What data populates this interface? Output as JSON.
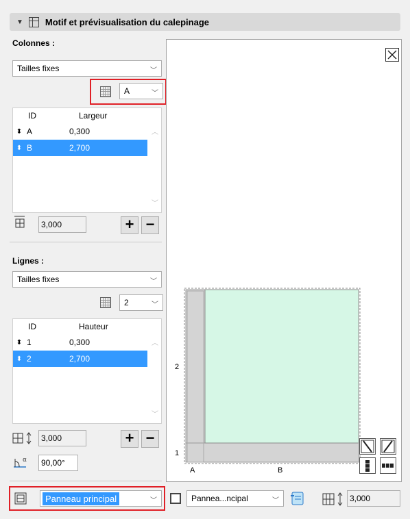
{
  "header": {
    "title": "Motif et prévisualisation du calepinage"
  },
  "columns": {
    "label": "Colonnes :",
    "mode": "Tailles fixes",
    "selector_value": "A",
    "table_headers": {
      "id": "ID",
      "value": "Largeur"
    },
    "rows": [
      {
        "id": "A",
        "value": "0,300"
      },
      {
        "id": "B",
        "value": "2,700"
      }
    ],
    "total": "3,000"
  },
  "rows_section": {
    "label": "Lignes :",
    "mode": "Tailles fixes",
    "selector_value": "2",
    "table_headers": {
      "id": "ID",
      "value": "Hauteur"
    },
    "rows": [
      {
        "id": "1",
        "value": "0,300"
      },
      {
        "id": "2",
        "value": "2,700"
      }
    ],
    "total": "3,000",
    "angle": "90,00°"
  },
  "preview": {
    "col_labels": [
      "A",
      "B"
    ],
    "row_labels": [
      "2",
      "1"
    ],
    "colors": {
      "panel_fill": "#d6f7e6",
      "frame": "#d4d4d4"
    }
  },
  "footer": {
    "panel_select": "Panneau principal",
    "panel_select2": "Pannea...ncipal",
    "height_value": "3,000"
  },
  "colors": {
    "highlight_red": "#e01f26",
    "selection_blue": "#3399ff"
  }
}
